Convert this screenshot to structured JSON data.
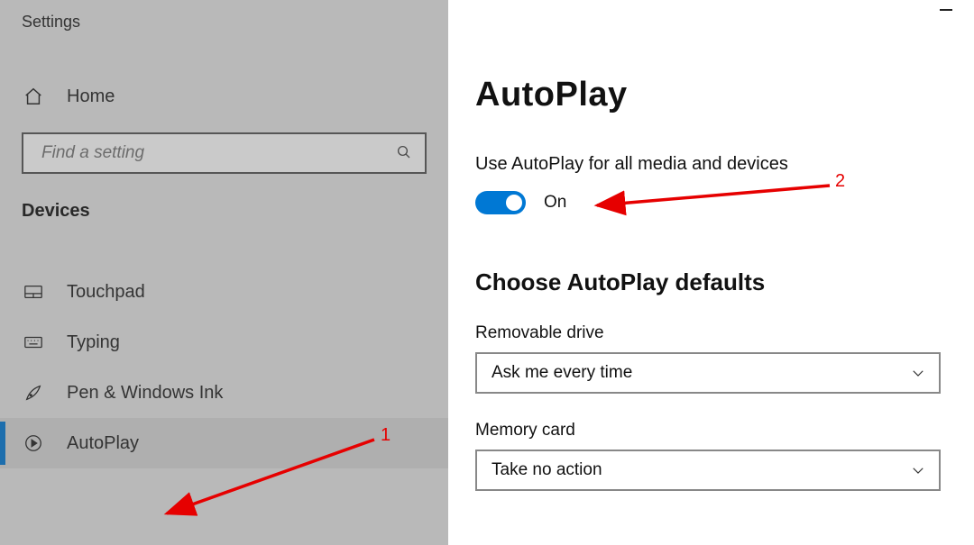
{
  "sidebar": {
    "app_title": "Settings",
    "home_label": "Home",
    "search_placeholder": "Find a setting",
    "category": "Devices",
    "items": [
      {
        "label": "Touchpad",
        "icon": "touchpad-icon",
        "selected": false
      },
      {
        "label": "Typing",
        "icon": "keyboard-icon",
        "selected": false
      },
      {
        "label": "Pen & Windows Ink",
        "icon": "pen-icon",
        "selected": false
      },
      {
        "label": "AutoPlay",
        "icon": "autoplay-icon",
        "selected": true
      }
    ]
  },
  "content": {
    "page_title": "AutoPlay",
    "toggle_label": "Use AutoPlay for all media and devices",
    "toggle_state": "On",
    "defaults_heading": "Choose AutoPlay defaults",
    "removable_label": "Removable drive",
    "removable_value": "Ask me every time",
    "memorycard_label": "Memory card",
    "memorycard_value": "Take no action"
  },
  "annotations": {
    "a1": "1",
    "a2": "2"
  },
  "colors": {
    "accent": "#0078d4",
    "arrow": "#e60000"
  }
}
